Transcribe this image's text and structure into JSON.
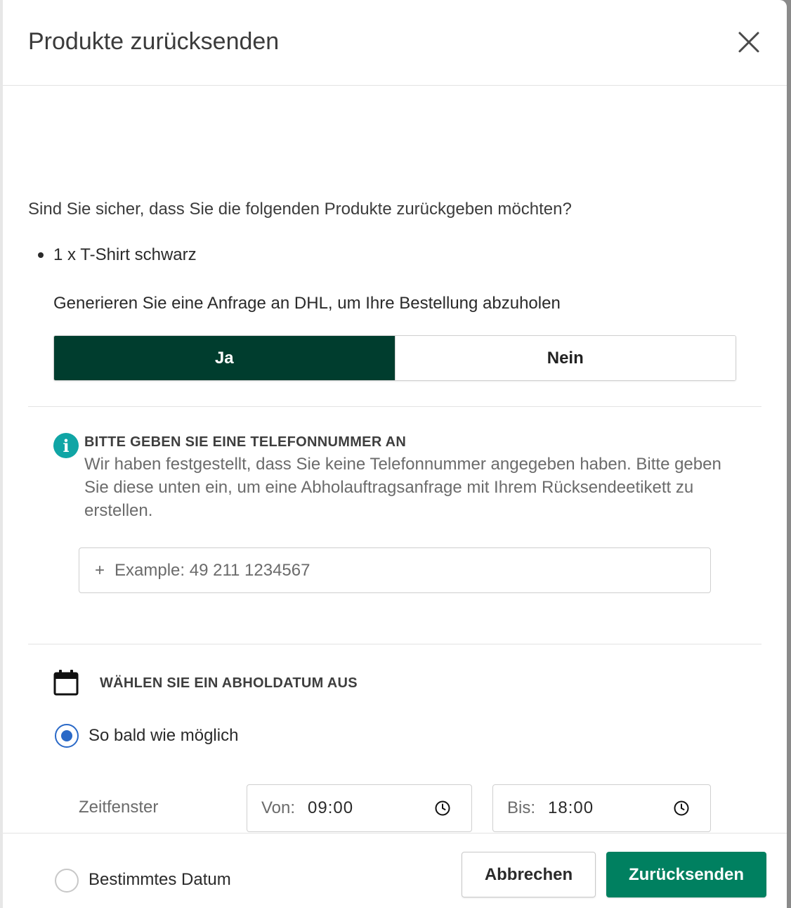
{
  "modal": {
    "title": "Produkte zurücksenden",
    "close_icon": "close-icon"
  },
  "question": "Sind Sie sicher, dass Sie die folgenden Produkte zurückgeben möchten?",
  "products": [
    {
      "label": "1 x T-Shirt schwarz"
    }
  ],
  "dhl": {
    "label": "Generieren Sie eine Anfrage an DHL, um Ihre Bestellung abzuholen",
    "options": [
      {
        "label": "Ja",
        "selected": true
      },
      {
        "label": "Nein",
        "selected": false
      }
    ],
    "active_color": "#003d2e"
  },
  "phone_notice": {
    "icon": "info-icon",
    "icon_color": "#10a5a5",
    "title": "BITTE GEBEN SIE EINE TELEFONNUMMER AN",
    "text": "Wir haben festgestellt, dass Sie keine Telefonnummer angegeben haben. Bitte geben Sie diese unten ein, um eine Abholauftragsanfrage mit Ihrem Rücksendeetikett zu erstellen.",
    "prefix": "+",
    "placeholder": "Example: 49 211 1234567",
    "value": ""
  },
  "pickup": {
    "icon": "calendar-icon",
    "title": "WÄHLEN SIE EIN ABHOLDATUM AUS",
    "options": [
      {
        "label": "So bald wie möglich",
        "selected": true
      },
      {
        "label": "Bestimmtes Datum",
        "selected": false
      }
    ],
    "time_window_label": "Zeitfenster",
    "from": {
      "prefix": "Von:",
      "value": "09:00",
      "icon": "clock-icon"
    },
    "to": {
      "prefix": "Bis:",
      "value": "18:00",
      "icon": "clock-icon"
    },
    "radio_color": "#2a69c7"
  },
  "footer": {
    "cancel_label": "Abbrechen",
    "submit_label": "Zurücksenden",
    "submit_color": "#008060"
  }
}
